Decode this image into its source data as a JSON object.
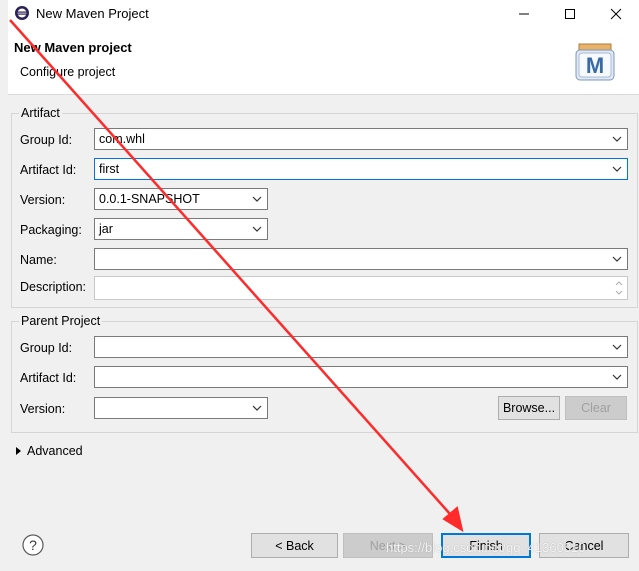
{
  "window": {
    "title": "New Maven Project",
    "minimize": "—",
    "maximize": "☐",
    "close": "✕"
  },
  "header": {
    "title": "New Maven project",
    "subtitle": "Configure project",
    "logo_letter": "M"
  },
  "artifact": {
    "legend": "Artifact",
    "group_id_label": "Group Id:",
    "group_id_value": "com.whl",
    "artifact_id_label": "Artifact Id:",
    "artifact_id_value": "first",
    "version_label": "Version:",
    "version_value": "0.0.1-SNAPSHOT",
    "packaging_label": "Packaging:",
    "packaging_value": "jar",
    "name_label": "Name:",
    "name_value": "",
    "description_label": "Description:",
    "description_value": ""
  },
  "parent": {
    "legend": "Parent Project",
    "group_id_label": "Group Id:",
    "group_id_value": "",
    "artifact_id_label": "Artifact Id:",
    "artifact_id_value": "",
    "version_label": "Version:",
    "version_value": "",
    "browse_label": "Browse...",
    "clear_label": "Clear"
  },
  "advanced": {
    "label": "Advanced"
  },
  "footer": {
    "help": "?",
    "back": "< Back",
    "next": "Next >",
    "finish": "Finish",
    "cancel": "Cancel"
  },
  "watermark": "https://blog.csdn.net/qq_41360810",
  "colors": {
    "annotation_arrow": "#ff2a2a",
    "focus_border": "#0078d7",
    "dialog_bg": "#f0f0f0"
  }
}
